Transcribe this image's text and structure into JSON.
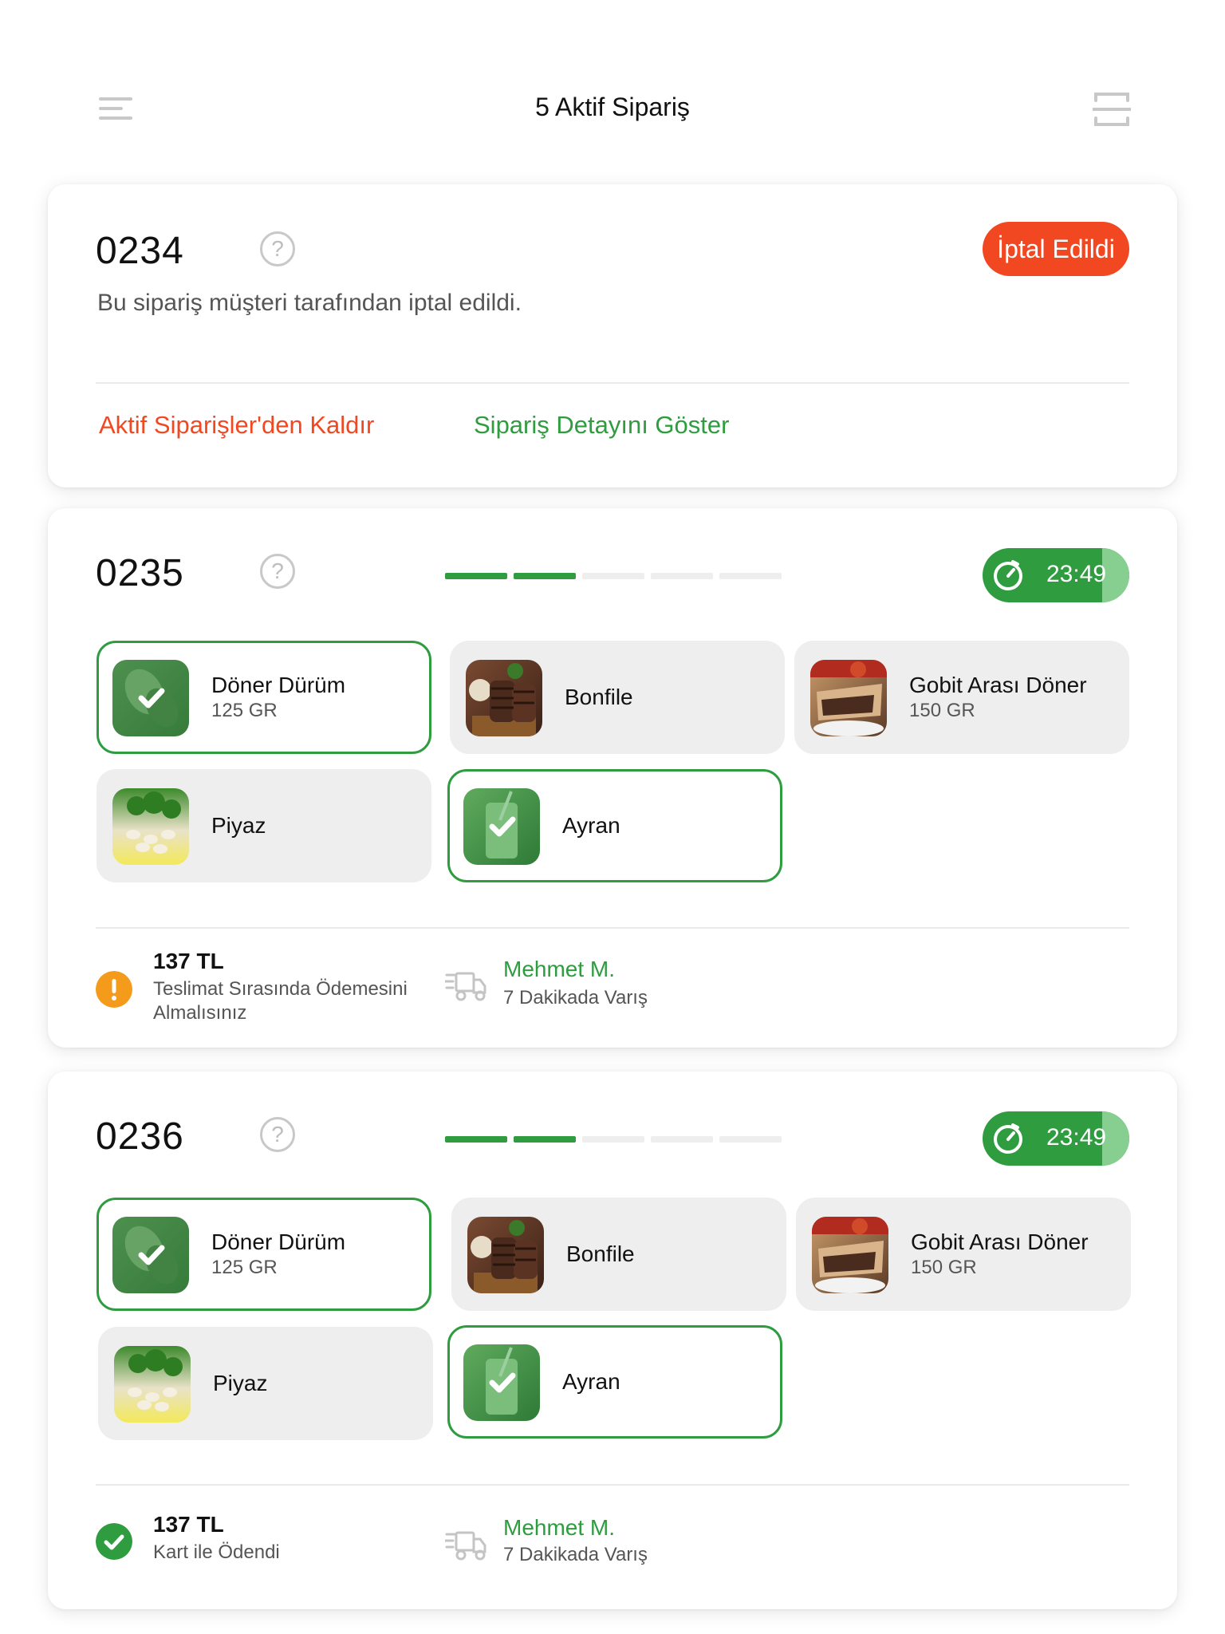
{
  "header": {
    "title": "5 Aktif Sipariş"
  },
  "colors": {
    "green": "#2e9c3f",
    "red": "#f24822",
    "orange": "#f59b1c"
  },
  "order0234": {
    "number": "0234",
    "status": "İptal Edildi",
    "message": "Bu sipariş müşteri tarafından iptal edildi.",
    "remove_link": "Aktif Siparişler'den Kaldır",
    "detail_link": "Sipariş Detayını Göster"
  },
  "order0235": {
    "number": "0235",
    "progress": {
      "completed_steps": 2,
      "total_steps": 5
    },
    "timer": "23:49",
    "items": [
      {
        "name": "Döner Dürüm",
        "sub": "125 GR",
        "done": true,
        "image": "wrap-food"
      },
      {
        "name": "Bonfile",
        "sub": "",
        "done": false,
        "image": "steak-food"
      },
      {
        "name": "Gobit Arası Döner",
        "sub": "150 GR",
        "done": false,
        "image": "doner-sandwich-food"
      },
      {
        "name": "Piyaz",
        "sub": "",
        "done": false,
        "image": "bean-salad-food"
      },
      {
        "name": "Ayran",
        "sub": "",
        "done": true,
        "image": "ayran-drink"
      }
    ],
    "payment": {
      "amount": "137 TL",
      "note": "Teslimat Sırasında Ödemesini Almalısınız",
      "icon": "warning-icon"
    },
    "courier": {
      "name": "Mehmet M.",
      "eta": "7 Dakikada Varış"
    }
  },
  "order0236": {
    "number": "0236",
    "progress": {
      "completed_steps": 2,
      "total_steps": 5
    },
    "timer": "23:49",
    "items": [
      {
        "name": "Döner Dürüm",
        "sub": "125 GR",
        "done": true,
        "image": "wrap-food"
      },
      {
        "name": "Bonfile",
        "sub": "",
        "done": false,
        "image": "steak-food"
      },
      {
        "name": "Gobit Arası Döner",
        "sub": "150 GR",
        "done": false,
        "image": "doner-sandwich-food"
      },
      {
        "name": "Piyaz",
        "sub": "",
        "done": false,
        "image": "bean-salad-food"
      },
      {
        "name": "Ayran",
        "sub": "",
        "done": true,
        "image": "ayran-drink"
      }
    ],
    "payment": {
      "amount": "137 TL",
      "note": "Kart ile Ödendi",
      "icon": "check-circle-icon"
    },
    "courier": {
      "name": "Mehmet M.",
      "eta": "7 Dakikada Varış"
    }
  }
}
